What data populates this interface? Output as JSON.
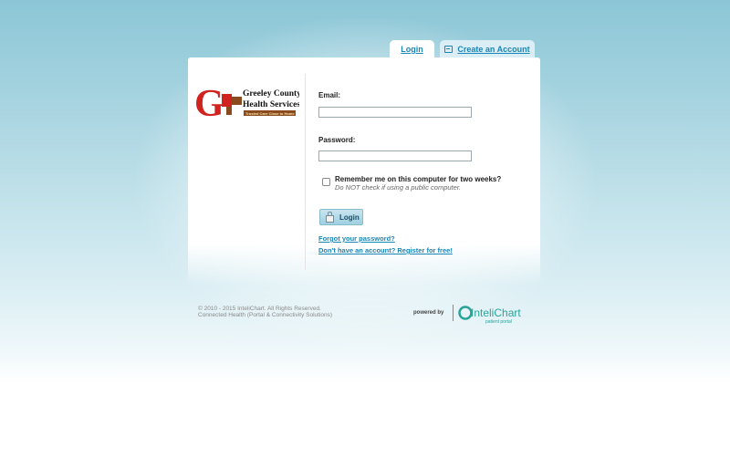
{
  "tabs": [
    {
      "label": "Login"
    },
    {
      "label": "Create an Account",
      "icon": "card-icon"
    }
  ],
  "logo": {
    "line1": "Greeley County",
    "line2": "Health Services",
    "tagline": "Trusted Care Close to Home",
    "letter": "G",
    "colors": {
      "red": "#d0231f",
      "brown": "#8b4a1d"
    }
  },
  "form": {
    "email_label": "Email:",
    "email_value": "",
    "password_label": "Password:",
    "password_value": "",
    "remember_label": "Remember me on this computer for two weeks?",
    "remember_note": "Do NOT check if using a public computer.",
    "remember_checked": false,
    "login_button": "Login",
    "forgot_link": "Forgot your password?",
    "register_link": "Don't have an account? Register for free!"
  },
  "footer": {
    "copyright": "© 2010 - 2015 InteliChart. All Rights Reserved.",
    "subline": "Connected Health (Portal & Connectivity Solutions)",
    "powered_by": "powered by",
    "brand": "InteliChart",
    "brand_sub": "patient portal",
    "brand_color": "#2aa39a"
  },
  "colors": {
    "link": "#1a86b6"
  }
}
